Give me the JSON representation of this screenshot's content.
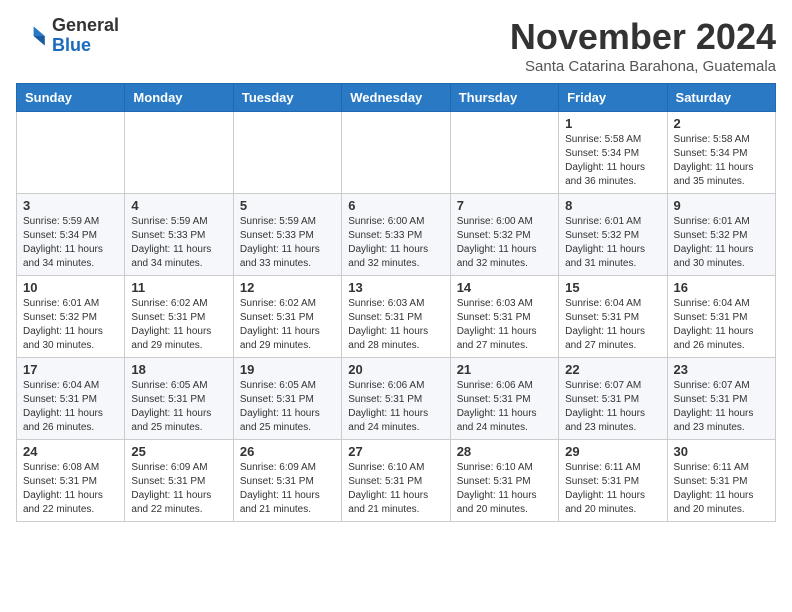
{
  "header": {
    "logo_general": "General",
    "logo_blue": "Blue",
    "month_title": "November 2024",
    "location": "Santa Catarina Barahona, Guatemala"
  },
  "weekdays": [
    "Sunday",
    "Monday",
    "Tuesday",
    "Wednesday",
    "Thursday",
    "Friday",
    "Saturday"
  ],
  "weeks": [
    [
      {
        "day": "",
        "info": ""
      },
      {
        "day": "",
        "info": ""
      },
      {
        "day": "",
        "info": ""
      },
      {
        "day": "",
        "info": ""
      },
      {
        "day": "",
        "info": ""
      },
      {
        "day": "1",
        "info": "Sunrise: 5:58 AM\nSunset: 5:34 PM\nDaylight: 11 hours and 36 minutes."
      },
      {
        "day": "2",
        "info": "Sunrise: 5:58 AM\nSunset: 5:34 PM\nDaylight: 11 hours and 35 minutes."
      }
    ],
    [
      {
        "day": "3",
        "info": "Sunrise: 5:59 AM\nSunset: 5:34 PM\nDaylight: 11 hours and 34 minutes."
      },
      {
        "day": "4",
        "info": "Sunrise: 5:59 AM\nSunset: 5:33 PM\nDaylight: 11 hours and 34 minutes."
      },
      {
        "day": "5",
        "info": "Sunrise: 5:59 AM\nSunset: 5:33 PM\nDaylight: 11 hours and 33 minutes."
      },
      {
        "day": "6",
        "info": "Sunrise: 6:00 AM\nSunset: 5:33 PM\nDaylight: 11 hours and 32 minutes."
      },
      {
        "day": "7",
        "info": "Sunrise: 6:00 AM\nSunset: 5:32 PM\nDaylight: 11 hours and 32 minutes."
      },
      {
        "day": "8",
        "info": "Sunrise: 6:01 AM\nSunset: 5:32 PM\nDaylight: 11 hours and 31 minutes."
      },
      {
        "day": "9",
        "info": "Sunrise: 6:01 AM\nSunset: 5:32 PM\nDaylight: 11 hours and 30 minutes."
      }
    ],
    [
      {
        "day": "10",
        "info": "Sunrise: 6:01 AM\nSunset: 5:32 PM\nDaylight: 11 hours and 30 minutes."
      },
      {
        "day": "11",
        "info": "Sunrise: 6:02 AM\nSunset: 5:31 PM\nDaylight: 11 hours and 29 minutes."
      },
      {
        "day": "12",
        "info": "Sunrise: 6:02 AM\nSunset: 5:31 PM\nDaylight: 11 hours and 29 minutes."
      },
      {
        "day": "13",
        "info": "Sunrise: 6:03 AM\nSunset: 5:31 PM\nDaylight: 11 hours and 28 minutes."
      },
      {
        "day": "14",
        "info": "Sunrise: 6:03 AM\nSunset: 5:31 PM\nDaylight: 11 hours and 27 minutes."
      },
      {
        "day": "15",
        "info": "Sunrise: 6:04 AM\nSunset: 5:31 PM\nDaylight: 11 hours and 27 minutes."
      },
      {
        "day": "16",
        "info": "Sunrise: 6:04 AM\nSunset: 5:31 PM\nDaylight: 11 hours and 26 minutes."
      }
    ],
    [
      {
        "day": "17",
        "info": "Sunrise: 6:04 AM\nSunset: 5:31 PM\nDaylight: 11 hours and 26 minutes."
      },
      {
        "day": "18",
        "info": "Sunrise: 6:05 AM\nSunset: 5:31 PM\nDaylight: 11 hours and 25 minutes."
      },
      {
        "day": "19",
        "info": "Sunrise: 6:05 AM\nSunset: 5:31 PM\nDaylight: 11 hours and 25 minutes."
      },
      {
        "day": "20",
        "info": "Sunrise: 6:06 AM\nSunset: 5:31 PM\nDaylight: 11 hours and 24 minutes."
      },
      {
        "day": "21",
        "info": "Sunrise: 6:06 AM\nSunset: 5:31 PM\nDaylight: 11 hours and 24 minutes."
      },
      {
        "day": "22",
        "info": "Sunrise: 6:07 AM\nSunset: 5:31 PM\nDaylight: 11 hours and 23 minutes."
      },
      {
        "day": "23",
        "info": "Sunrise: 6:07 AM\nSunset: 5:31 PM\nDaylight: 11 hours and 23 minutes."
      }
    ],
    [
      {
        "day": "24",
        "info": "Sunrise: 6:08 AM\nSunset: 5:31 PM\nDaylight: 11 hours and 22 minutes."
      },
      {
        "day": "25",
        "info": "Sunrise: 6:09 AM\nSunset: 5:31 PM\nDaylight: 11 hours and 22 minutes."
      },
      {
        "day": "26",
        "info": "Sunrise: 6:09 AM\nSunset: 5:31 PM\nDaylight: 11 hours and 21 minutes."
      },
      {
        "day": "27",
        "info": "Sunrise: 6:10 AM\nSunset: 5:31 PM\nDaylight: 11 hours and 21 minutes."
      },
      {
        "day": "28",
        "info": "Sunrise: 6:10 AM\nSunset: 5:31 PM\nDaylight: 11 hours and 20 minutes."
      },
      {
        "day": "29",
        "info": "Sunrise: 6:11 AM\nSunset: 5:31 PM\nDaylight: 11 hours and 20 minutes."
      },
      {
        "day": "30",
        "info": "Sunrise: 6:11 AM\nSunset: 5:31 PM\nDaylight: 11 hours and 20 minutes."
      }
    ]
  ]
}
